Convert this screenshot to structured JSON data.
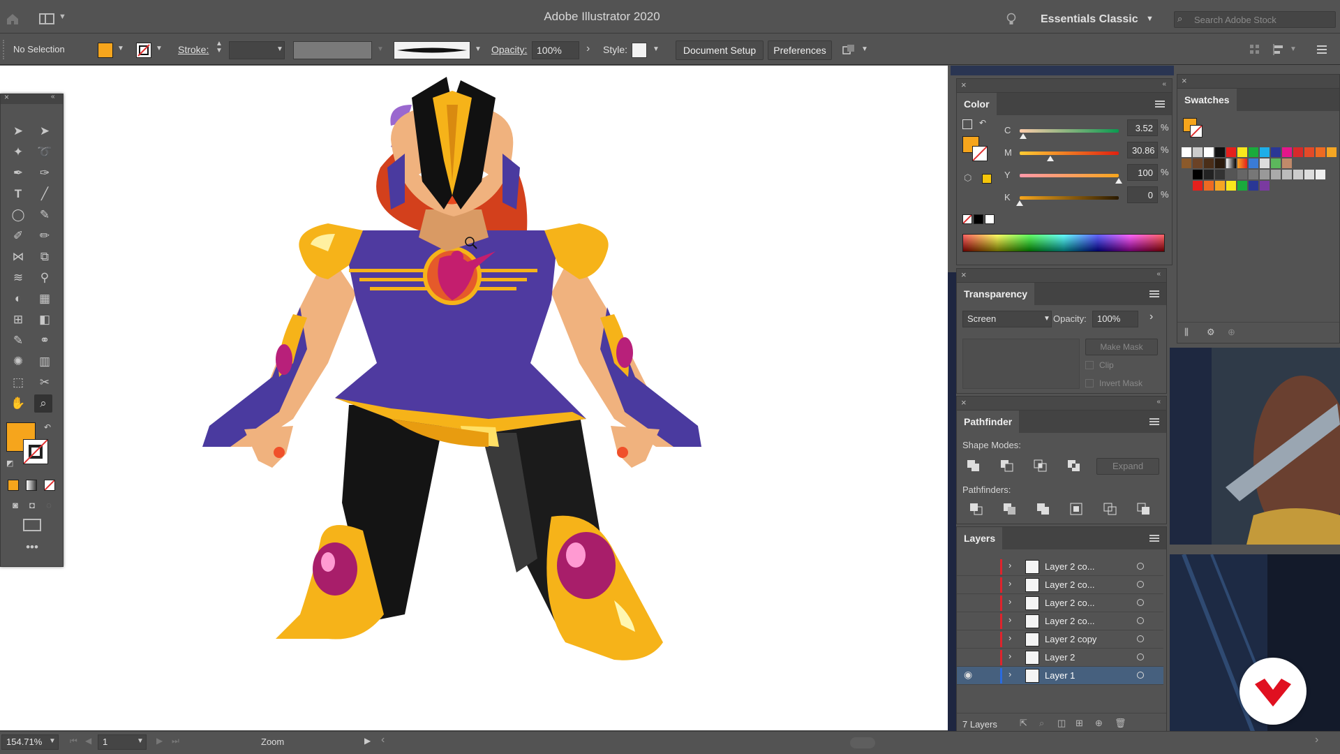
{
  "app": {
    "title": "Adobe Illustrator 2020",
    "workspace": "Essentials Classic",
    "search_placeholder": "Search Adobe Stock"
  },
  "control_bar": {
    "selection": "No Selection",
    "stroke_label": "Stroke:",
    "opacity_label": "Opacity:",
    "opacity_value": "100%",
    "style_label": "Style:",
    "document_setup": "Document Setup",
    "preferences": "Preferences"
  },
  "colors": {
    "fill": "#f6a51c",
    "panel": "#535353",
    "canvas": "#ffffff",
    "selected_layer": "#46607e"
  },
  "color_panel": {
    "title": "Color",
    "channels": [
      {
        "label": "C",
        "value": "3.52",
        "unit": "%",
        "fraction": 0.035
      },
      {
        "label": "M",
        "value": "30.86",
        "unit": "%",
        "fraction": 0.31
      },
      {
        "label": "Y",
        "value": "100",
        "unit": "%",
        "fraction": 1.0
      },
      {
        "label": "K",
        "value": "0",
        "unit": "%",
        "fraction": 0.0
      }
    ]
  },
  "swatches_panel": {
    "title": "Swatches"
  },
  "transparency_panel": {
    "title": "Transparency",
    "blend_mode": "Screen",
    "opacity_label": "Opacity:",
    "opacity_value": "100%",
    "make_mask": "Make Mask",
    "clip": "Clip",
    "invert_mask": "Invert Mask"
  },
  "pathfinder_panel": {
    "title": "Pathfinder",
    "shape_modes": "Shape Modes:",
    "expand": "Expand",
    "pathfinders": "Pathfinders:"
  },
  "layers_panel": {
    "title": "Layers",
    "layers": [
      {
        "name": "Layer 2 co..."
      },
      {
        "name": "Layer 2 co..."
      },
      {
        "name": "Layer 2 co..."
      },
      {
        "name": "Layer 2 co..."
      },
      {
        "name": "Layer 2 copy"
      },
      {
        "name": "Layer 2"
      },
      {
        "name": "Layer 1"
      }
    ],
    "footer": "7 Layers"
  },
  "status_bar": {
    "zoom": "154.71%",
    "artboard": "1",
    "tool": "Zoom"
  }
}
